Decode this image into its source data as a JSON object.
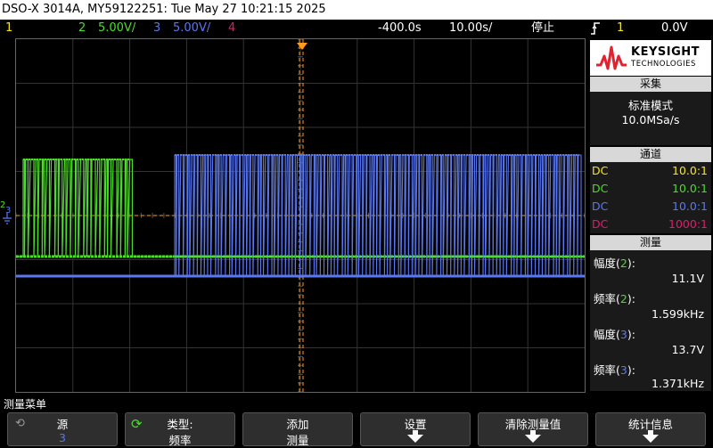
{
  "title": "DSO-X 3014A, MY59122251: Tue May 27 10:21:15 2025",
  "status": {
    "ch1": "1",
    "ch2": "2",
    "ch2_scale": "5.00V/",
    "ch3": "3",
    "ch3_scale": "5.00V/",
    "ch4": "4",
    "delay": "-400.0s",
    "timebase": "10.00s/",
    "run_state": "停止",
    "trigger_icon": "rising-edge-trigger-icon",
    "trigger_source": "1",
    "trigger_level": "0.0V"
  },
  "colors": {
    "ch1": "#f5e61e",
    "ch2": "#4cdc2a",
    "ch3": "#5a78f0",
    "ch4": "#e8186e",
    "trigger": "#ff9a1a"
  },
  "panel": {
    "logo_brand": "KEYSIGHT",
    "logo_sub": "TECHNOLOGIES",
    "acq_header": "采集",
    "acq_mode": "标准模式",
    "acq_rate": "10.0MSa/s",
    "channels_header": "通道",
    "channels": [
      {
        "coupling": "DC",
        "ratio": "10.0:1"
      },
      {
        "coupling": "DC",
        "ratio": "10.0:1"
      },
      {
        "coupling": "DC",
        "ratio": "10.0:1"
      },
      {
        "coupling": "DC",
        "ratio": "1000:1"
      }
    ],
    "measure_header": "测量",
    "measurements": [
      {
        "label": "幅度",
        "src": "2",
        "value": "11.1V"
      },
      {
        "label": "频率",
        "src": "2",
        "value": "1.599kHz"
      },
      {
        "label": "幅度",
        "src": "3",
        "value": "13.7V"
      },
      {
        "label": "频率",
        "src": "3",
        "value": "1.371kHz"
      }
    ]
  },
  "menu_title": "测量菜单",
  "softkeys": {
    "source_label": "源",
    "source_value": "3",
    "type_label": "类型:",
    "type_value": "频率",
    "add_l1": "添加",
    "add_l2": "测量",
    "settings": "设置",
    "clear": "清除测量值",
    "stats": "统计信息"
  },
  "screen_markers": {
    "ch2_marker": "2",
    "ch3_marker": "3"
  }
}
